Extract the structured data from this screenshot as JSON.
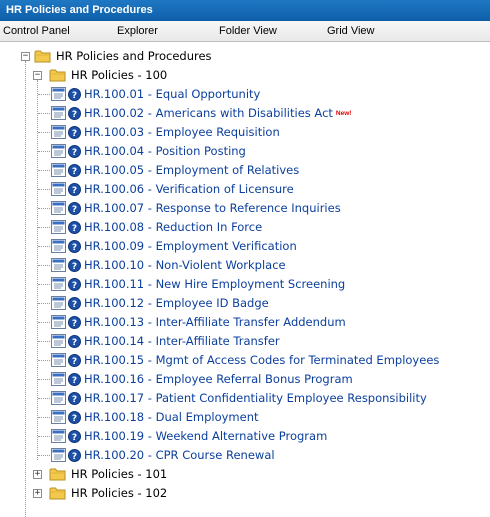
{
  "window": {
    "title": "HR Policies and Procedures"
  },
  "menu": {
    "items": [
      "Control Panel",
      "Explorer",
      "Folder View",
      "Grid View"
    ]
  },
  "tree": {
    "root": {
      "label": "HR Policies and Procedures",
      "expander": "−"
    },
    "folder_100": {
      "label": "HR Policies - 100",
      "expander": "−"
    },
    "documents": [
      {
        "label": "HR.100.01 - Equal Opportunity",
        "badge": ""
      },
      {
        "label": "HR.100.02 - Americans with Disabilities Act",
        "badge": "New!"
      },
      {
        "label": "HR.100.03 - Employee Requisition",
        "badge": ""
      },
      {
        "label": "HR.100.04 - Position Posting",
        "badge": ""
      },
      {
        "label": "HR.100.05 - Employment of Relatives",
        "badge": ""
      },
      {
        "label": "HR.100.06 - Verification of Licensure",
        "badge": ""
      },
      {
        "label": "HR.100.07 - Response to Reference Inquiries",
        "badge": ""
      },
      {
        "label": "HR.100.08 - Reduction In Force",
        "badge": ""
      },
      {
        "label": "HR.100.09 - Employment Verification",
        "badge": ""
      },
      {
        "label": "HR.100.10 - Non-Violent Workplace",
        "badge": ""
      },
      {
        "label": "HR.100.11 - New Hire Employment Screening",
        "badge": ""
      },
      {
        "label": "HR.100.12 - Employee ID Badge",
        "badge": ""
      },
      {
        "label": "HR.100.13 - Inter-Affiliate Transfer Addendum",
        "badge": ""
      },
      {
        "label": "HR.100.14 - Inter-Affiliate Transfer",
        "badge": ""
      },
      {
        "label": "HR.100.15 - Mgmt of Access Codes for Terminated Employees",
        "badge": ""
      },
      {
        "label": "HR.100.16 - Employee Referral Bonus Program",
        "badge": ""
      },
      {
        "label": "HR.100.17 - Patient Confidentiality Employee Responsibility",
        "badge": ""
      },
      {
        "label": "HR.100.18 - Dual Employment",
        "badge": ""
      },
      {
        "label": "HR.100.19 - Weekend Alternative Program",
        "badge": ""
      },
      {
        "label": "HR.100.20 - CPR Course Renewal",
        "badge": ""
      }
    ],
    "collapsed_folders": [
      {
        "label": "HR Policies - 101",
        "expander": "+"
      },
      {
        "label": "HR Policies - 102",
        "expander": "+"
      }
    ]
  },
  "icons": {
    "folder": "folder-icon",
    "document": "document-icon",
    "help": "help-icon"
  },
  "colors": {
    "titlebar": "#0e5ea8",
    "link": "#0b3f9e",
    "badge": "#e00000",
    "folder": "#f2c94c"
  }
}
